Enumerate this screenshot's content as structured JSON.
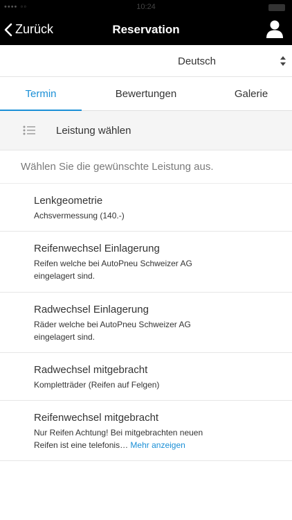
{
  "status_bar": {
    "signal": "•••• ◦◦",
    "time": "10:24"
  },
  "nav": {
    "back_label": "Zurück",
    "title": "Reservation"
  },
  "language": {
    "selected": "Deutsch"
  },
  "tabs": [
    {
      "label": "Termin",
      "active": true
    },
    {
      "label": "Bewertungen",
      "active": false
    },
    {
      "label": "Galerie",
      "active": false
    }
  ],
  "section": {
    "title": "Leistung wählen"
  },
  "hint": "Wählen Sie die gewünschte Leistung aus.",
  "services": [
    {
      "name": "Lenkgeometrie",
      "desc_line1": "Achsvermessung (140.-)",
      "desc_line2": ""
    },
    {
      "name": "Reifenwechsel Einlagerung",
      "desc_line1": "Reifen welche bei AutoPneu Schweizer AG",
      "desc_line2": "eingelagert sind."
    },
    {
      "name": "Radwechsel Einlagerung",
      "desc_line1": "Räder welche bei AutoPneu Schweizer AG",
      "desc_line2": "eingelagert sind."
    },
    {
      "name": "Radwechsel mitgebracht",
      "desc_line1": "Kompletträder (Reifen auf Felgen)",
      "desc_line2": ""
    },
    {
      "name": "Reifenwechsel mitgebracht",
      "desc_line1": "Nur Reifen Achtung! Bei mitgebrachten neuen",
      "desc_line2": "Reifen ist eine telefonis…",
      "more_label": "Mehr anzeigen"
    }
  ],
  "colors": {
    "accent": "#1a8fd6",
    "nav_bg": "#000000",
    "section_bg": "#f5f5f5"
  },
  "icons": {
    "back": "chevron-left-icon",
    "profile": "user-icon",
    "select": "updown-arrows-icon",
    "section": "list-icon"
  }
}
